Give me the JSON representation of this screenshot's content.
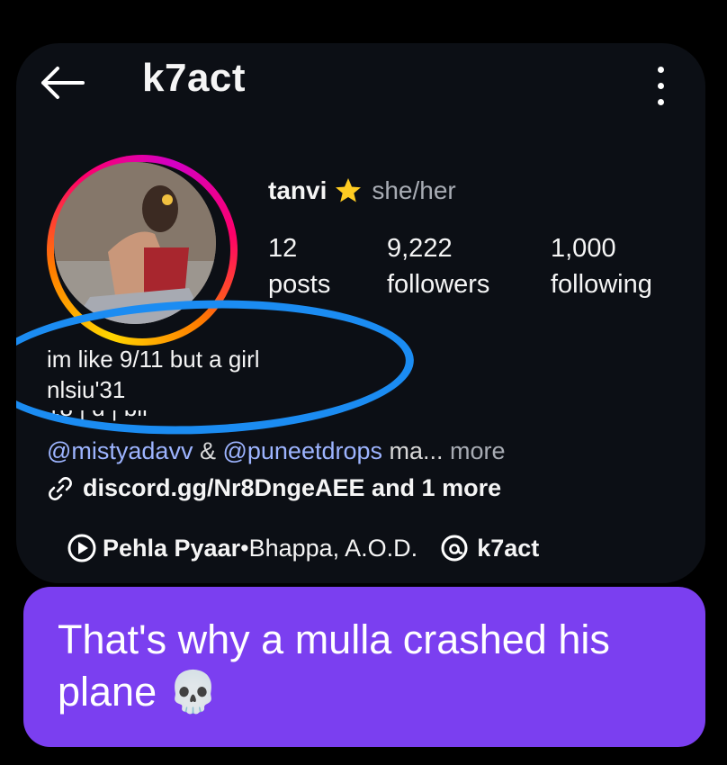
{
  "header": {
    "handle": "k7act",
    "back_icon": "arrow-left-icon",
    "menu_icon": "more-vertical-icon"
  },
  "profile": {
    "display_name": "tanvi",
    "badge_icon": "star-emoji-icon",
    "pronouns": "she/her",
    "stats": [
      {
        "value": "12",
        "label": "posts"
      },
      {
        "value": "9,222",
        "label": "followers"
      },
      {
        "value": "1,000",
        "label": "following"
      }
    ]
  },
  "bio": {
    "line1": "im like 9/11 but a girl",
    "line2": "nlsiu'31",
    "line3_partial": "18 | d | blr",
    "mention1": "@mistyadavv",
    "mention_sep": " & ",
    "mention2": "@puneetdrops",
    "mention_tail": " ma...",
    "more_label": " more",
    "link_text": "discord.gg/Nr8DngeAEE and 1 more"
  },
  "music": {
    "song": "Pehla Pyaar",
    "separator": " • ",
    "artist": "Bhappa, A.O.D.",
    "threads_handle": "k7act"
  },
  "annotation": {
    "color": "#1b8cf2"
  },
  "message": {
    "text": "That's why a mulla crashed his plane 💀",
    "bubble_color": "#7b3ff0"
  }
}
